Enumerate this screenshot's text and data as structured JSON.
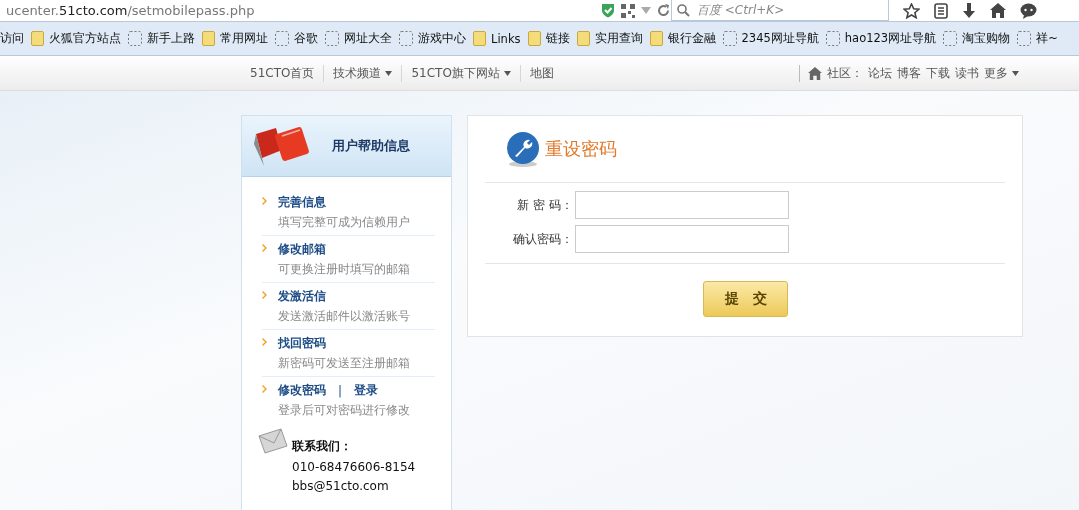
{
  "browser": {
    "url_host": "ucenter.",
    "url_domain": "51cto.com",
    "url_path": "/setmobilepass.php",
    "search": {
      "placeholder": "百度 <Ctrl+K>"
    }
  },
  "bookmarks": [
    {
      "label": "访问",
      "kind": "plain"
    },
    {
      "label": "火狐官方站点",
      "kind": "folder"
    },
    {
      "label": "新手上路",
      "kind": "page"
    },
    {
      "label": "常用网址",
      "kind": "folder"
    },
    {
      "label": "谷歌",
      "kind": "page"
    },
    {
      "label": "网址大全",
      "kind": "page"
    },
    {
      "label": "游戏中心",
      "kind": "page"
    },
    {
      "label": "Links",
      "kind": "folder"
    },
    {
      "label": "链接",
      "kind": "folder"
    },
    {
      "label": "实用查询",
      "kind": "folder"
    },
    {
      "label": "银行金融",
      "kind": "folder"
    },
    {
      "label": "2345网址导航",
      "kind": "page"
    },
    {
      "label": "hao123网址导航",
      "kind": "page"
    },
    {
      "label": "淘宝购物",
      "kind": "page"
    },
    {
      "label": "祥~",
      "kind": "page"
    }
  ],
  "site_nav": {
    "links": [
      {
        "label": "51CTO首页",
        "dropdown": false
      },
      {
        "label": "技术频道",
        "dropdown": true
      },
      {
        "label": "51CTO旗下网站",
        "dropdown": true
      },
      {
        "label": "地图",
        "dropdown": false
      }
    ],
    "community_label": "社区：",
    "community_links": [
      "论坛",
      "博客",
      "下载",
      "读书"
    ],
    "more": "更多"
  },
  "sidebar": {
    "title": "用户帮助信息",
    "items": [
      {
        "links": [
          "完善信息"
        ],
        "desc": "填写完整可成为信赖用户"
      },
      {
        "links": [
          "修改邮箱"
        ],
        "desc": "可更换注册时填写的邮箱"
      },
      {
        "links": [
          "发激活信"
        ],
        "desc": "发送激活邮件以激活账号"
      },
      {
        "links": [
          "找回密码"
        ],
        "desc": "新密码可发送至注册邮箱"
      },
      {
        "links": [
          "修改密码",
          "登录"
        ],
        "separator": "|",
        "desc": "登录后可对密码进行修改"
      }
    ],
    "contact": {
      "title": "联系我们：",
      "phone": "010-68476606-8154",
      "email": "bbs@51cto.com"
    }
  },
  "form": {
    "title": "重设密码",
    "fields": [
      {
        "label": "新 密 码："
      },
      {
        "label": "确认密码："
      }
    ],
    "submit": "提　交"
  }
}
